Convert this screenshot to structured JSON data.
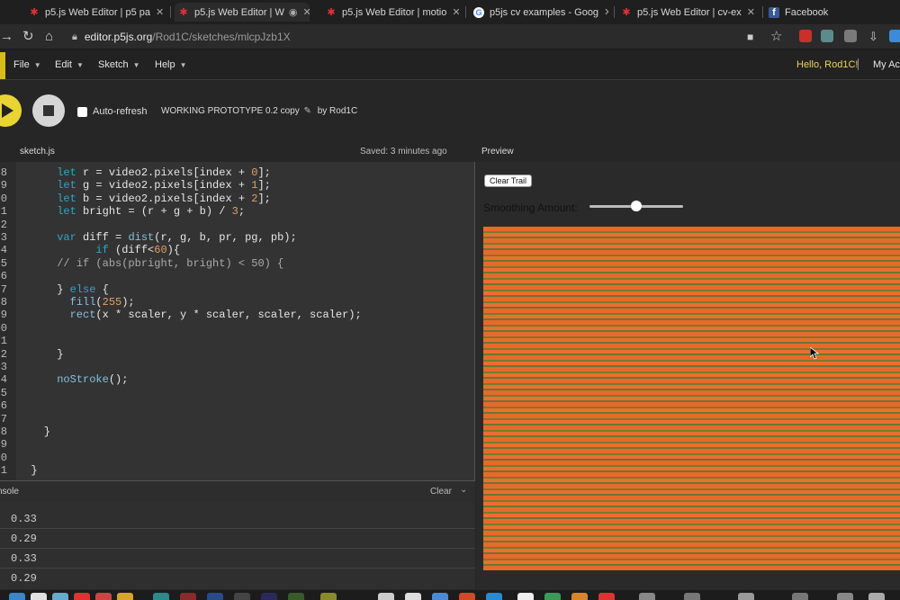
{
  "tabs": [
    {
      "title": "p5.js Web Editor | p5 pa",
      "icon": "p5-icon"
    },
    {
      "title": "p5.js Web Editor | W",
      "icon": "p5-icon"
    },
    {
      "title": "p5.js Web Editor | motio",
      "icon": "p5-icon"
    },
    {
      "title": "p5js cv examples - Goog",
      "icon": "google-icon"
    },
    {
      "title": "p5.js Web Editor | cv-ex",
      "icon": "p5-icon"
    },
    {
      "title": "Facebook",
      "icon": "facebook-icon"
    }
  ],
  "address": {
    "domain": "editor.p5js.org",
    "path": "/Rod1C/sketches/mlcpJzb1X"
  },
  "menu": {
    "file": "File",
    "edit": "Edit",
    "sketch": "Sketch",
    "help": "Help",
    "hello": "Hello, Rod1C!",
    "my_account": "My Ac"
  },
  "toolbar": {
    "autorefresh_label": "Auto-refresh",
    "project_name": "WORKING PROTOTYPE 0.2 copy",
    "by": "by Rod1C"
  },
  "editor": {
    "filename": "sketch.js",
    "saved": "Saved: 3 minutes ago",
    "line_numbers": [
      "8",
      "9",
      "0",
      "1",
      "2",
      "3",
      "4",
      "5",
      "6",
      "7",
      "8",
      "9",
      "0",
      "1",
      "2",
      "3",
      "4",
      "5",
      "6",
      "7",
      "8",
      "9",
      "0",
      "1"
    ]
  },
  "preview": {
    "label": "Preview",
    "clear_trail": "Clear Trail",
    "smoothing_label": "Smoothing Amount:",
    "smoothing_value": 0.5
  },
  "console": {
    "label": "nsole",
    "clear": "Clear",
    "values": [
      "0.33",
      "0.29",
      "0.33",
      "0.29"
    ]
  },
  "colors": {
    "accent": "#ead432",
    "canvas_orange": "#e76a2b",
    "canvas_olive": "#7a7a2a"
  }
}
